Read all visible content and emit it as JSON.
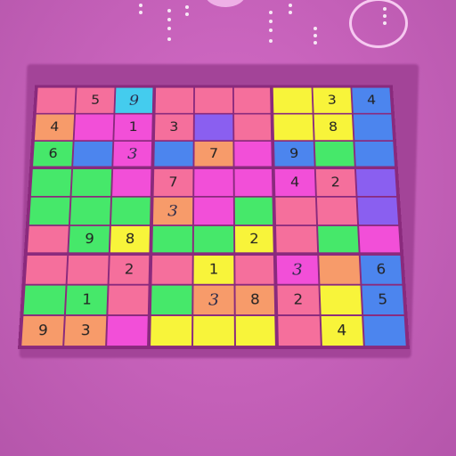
{
  "palette": {
    "P": "#f56f9c",
    "K": "#f24fd8",
    "Y": "#f8f43a",
    "G": "#46e86a",
    "B": "#4c85ee",
    "L": "#8a5ff0",
    "O": "#f79b6a",
    "C": "#44ccee"
  },
  "board": {
    "rows": [
      [
        {
          "c": "P",
          "v": ""
        },
        {
          "c": "P",
          "v": "5"
        },
        {
          "c": "C",
          "v": "9",
          "hand": true
        },
        {
          "c": "P",
          "v": ""
        },
        {
          "c": "P",
          "v": ""
        },
        {
          "c": "P",
          "v": ""
        },
        {
          "c": "Y",
          "v": ""
        },
        {
          "c": "Y",
          "v": "3"
        },
        {
          "c": "B",
          "v": "4"
        }
      ],
      [
        {
          "c": "O",
          "v": "4"
        },
        {
          "c": "K",
          "v": ""
        },
        {
          "c": "K",
          "v": "1"
        },
        {
          "c": "P",
          "v": "3"
        },
        {
          "c": "L",
          "v": ""
        },
        {
          "c": "P",
          "v": ""
        },
        {
          "c": "Y",
          "v": ""
        },
        {
          "c": "Y",
          "v": "8"
        },
        {
          "c": "B",
          "v": ""
        }
      ],
      [
        {
          "c": "G",
          "v": "6"
        },
        {
          "c": "B",
          "v": ""
        },
        {
          "c": "K",
          "v": "3",
          "hand": true
        },
        {
          "c": "B",
          "v": ""
        },
        {
          "c": "O",
          "v": "7"
        },
        {
          "c": "K",
          "v": ""
        },
        {
          "c": "B",
          "v": "9"
        },
        {
          "c": "G",
          "v": ""
        },
        {
          "c": "B",
          "v": ""
        }
      ],
      [
        {
          "c": "G",
          "v": ""
        },
        {
          "c": "G",
          "v": ""
        },
        {
          "c": "K",
          "v": ""
        },
        {
          "c": "P",
          "v": "7"
        },
        {
          "c": "K",
          "v": ""
        },
        {
          "c": "K",
          "v": ""
        },
        {
          "c": "K",
          "v": "4"
        },
        {
          "c": "P",
          "v": "2"
        },
        {
          "c": "L",
          "v": ""
        }
      ],
      [
        {
          "c": "G",
          "v": ""
        },
        {
          "c": "G",
          "v": ""
        },
        {
          "c": "G",
          "v": ""
        },
        {
          "c": "O",
          "v": "3",
          "hand": true
        },
        {
          "c": "K",
          "v": ""
        },
        {
          "c": "G",
          "v": ""
        },
        {
          "c": "P",
          "v": ""
        },
        {
          "c": "P",
          "v": ""
        },
        {
          "c": "L",
          "v": ""
        }
      ],
      [
        {
          "c": "P",
          "v": ""
        },
        {
          "c": "G",
          "v": "9"
        },
        {
          "c": "Y",
          "v": "8"
        },
        {
          "c": "G",
          "v": ""
        },
        {
          "c": "G",
          "v": ""
        },
        {
          "c": "Y",
          "v": "2"
        },
        {
          "c": "P",
          "v": ""
        },
        {
          "c": "G",
          "v": ""
        },
        {
          "c": "K",
          "v": ""
        }
      ],
      [
        {
          "c": "P",
          "v": ""
        },
        {
          "c": "P",
          "v": ""
        },
        {
          "c": "P",
          "v": "2"
        },
        {
          "c": "P",
          "v": ""
        },
        {
          "c": "Y",
          "v": "1"
        },
        {
          "c": "P",
          "v": ""
        },
        {
          "c": "K",
          "v": "3",
          "hand": true
        },
        {
          "c": "O",
          "v": ""
        },
        {
          "c": "B",
          "v": "6"
        }
      ],
      [
        {
          "c": "G",
          "v": ""
        },
        {
          "c": "G",
          "v": "1"
        },
        {
          "c": "P",
          "v": ""
        },
        {
          "c": "G",
          "v": ""
        },
        {
          "c": "O",
          "v": "3",
          "hand": true
        },
        {
          "c": "O",
          "v": "8"
        },
        {
          "c": "P",
          "v": "2"
        },
        {
          "c": "Y",
          "v": ""
        },
        {
          "c": "B",
          "v": "5"
        }
      ],
      [
        {
          "c": "O",
          "v": "9"
        },
        {
          "c": "O",
          "v": "3"
        },
        {
          "c": "K",
          "v": ""
        },
        {
          "c": "Y",
          "v": ""
        },
        {
          "c": "Y",
          "v": ""
        },
        {
          "c": "Y",
          "v": ""
        },
        {
          "c": "P",
          "v": ""
        },
        {
          "c": "Y",
          "v": "4"
        },
        {
          "c": "B",
          "v": ""
        }
      ]
    ]
  }
}
